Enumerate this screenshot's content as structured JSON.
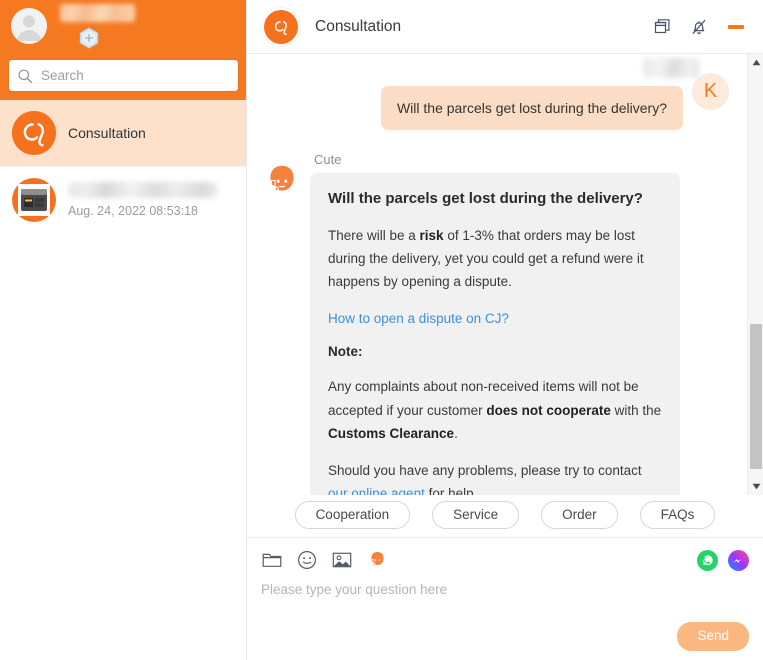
{
  "sidebar": {
    "account": {
      "avatar_name": "user-avatar",
      "username_masked": "",
      "badge_icon": "hexagon-badge-icon"
    },
    "search": {
      "placeholder": "Search",
      "value": "",
      "icon": "search-icon"
    },
    "conversations": [
      {
        "title": "Consultation",
        "time": "",
        "avatar_icon": "cj-logo-icon",
        "active": true,
        "masked_title": false
      },
      {
        "title": "",
        "time": "Aug. 24, 2022 08:53:18",
        "avatar_icon": "product-thumbnail-icon",
        "active": false,
        "masked_title": true
      }
    ]
  },
  "header": {
    "logo_icon": "cj-logo-icon",
    "title": "Consultation",
    "buttons": [
      {
        "name": "restore-window-button",
        "icon": "restore-window-icon"
      },
      {
        "name": "notifications-muted-button",
        "icon": "bell-muted-icon"
      },
      {
        "name": "minimize-window-button",
        "icon": "minimize-icon"
      }
    ],
    "accent_color": "#f57920"
  },
  "messages": {
    "user": {
      "name_masked": "",
      "avatar_initial": "K",
      "text": "Will the parcels get lost during the delivery?"
    },
    "bot": {
      "name": "Cute",
      "avatar_icon": "support-agent-icon",
      "title": "Will the parcels get lost during the delivery?",
      "paragraph1_pre": "There will be a ",
      "paragraph1_bold": "risk",
      "paragraph1_post": " of 1-3% that orders may be lost during the delivery, yet you could get a refund were it happens by opening a dispute.",
      "link1": "How to open a dispute on CJ?",
      "note_label": "Note:",
      "paragraph2_pre": "Any complaints about non-received items will not be accepted if your customer ",
      "paragraph2_bold1": "does not cooperate",
      "paragraph2_mid": " with the ",
      "paragraph2_bold2": "Customs Clearance",
      "paragraph2_post": ".",
      "paragraph3_pre": "Should you have any problems, please try to contact ",
      "paragraph3_link": "our online agent",
      "paragraph3_post": " for help."
    }
  },
  "quick_replies": [
    {
      "label": "Cooperation"
    },
    {
      "label": "Service"
    },
    {
      "label": "Order"
    },
    {
      "label": "FAQs"
    }
  ],
  "composer": {
    "tools": [
      {
        "name": "file-folder-button",
        "icon": "folder-icon"
      },
      {
        "name": "emoji-button",
        "icon": "smiley-icon"
      },
      {
        "name": "image-button",
        "icon": "image-icon"
      },
      {
        "name": "live-agent-button",
        "icon": "support-agent-icon"
      }
    ],
    "social": [
      {
        "name": "whatsapp-button",
        "icon": "whatsapp-icon",
        "color": "#25d366"
      },
      {
        "name": "messenger-button",
        "icon": "messenger-icon",
        "color": "#a033ff"
      }
    ],
    "input_placeholder": "Please type your question here",
    "input_value": "",
    "send_label": "Send"
  },
  "scrollbar": {
    "up_arrow": "scroll-up-arrow-icon",
    "down_arrow": "scroll-down-arrow-icon"
  }
}
